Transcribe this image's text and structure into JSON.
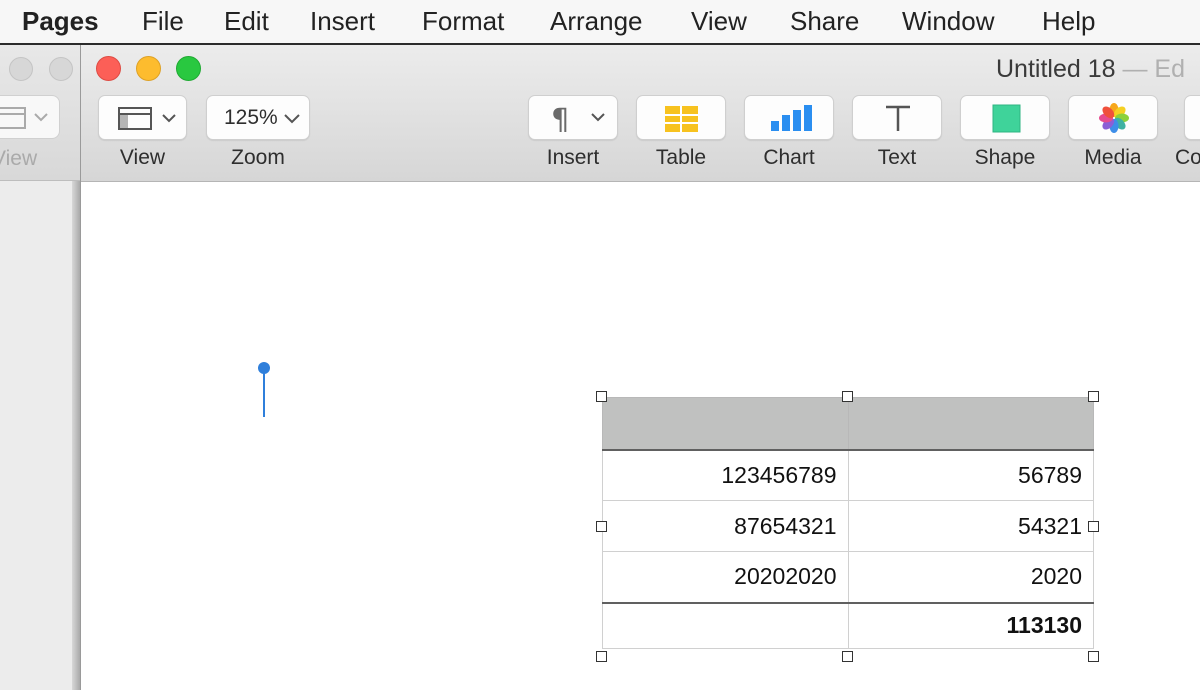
{
  "menubar": {
    "items": [
      "Pages",
      "File",
      "Edit",
      "Insert",
      "Format",
      "Arrange",
      "View",
      "Share",
      "Window",
      "Help"
    ]
  },
  "background_window": {
    "view_label": "View"
  },
  "window": {
    "title": "Untitled 18",
    "title_suffix": "— Ed"
  },
  "toolbar": {
    "view": {
      "label": "View",
      "icon": "sidebar-layout-icon"
    },
    "zoom": {
      "label": "Zoom",
      "value": "125%"
    },
    "insert": {
      "label": "Insert",
      "icon": "pilcrow-icon"
    },
    "table": {
      "label": "Table",
      "icon": "table-icon",
      "color": "#f7c21f"
    },
    "chart": {
      "label": "Chart",
      "icon": "bar-chart-icon",
      "color": "#2a8ef0"
    },
    "text": {
      "label": "Text",
      "icon": "text-t-icon"
    },
    "shape": {
      "label": "Shape",
      "icon": "square-shape-icon",
      "color": "#3fd39a"
    },
    "media": {
      "label": "Media",
      "icon": "photos-flower-icon"
    },
    "comment": {
      "label": "Co"
    }
  },
  "table": {
    "header": [
      "",
      ""
    ],
    "rows": [
      [
        "123456789",
        "56789"
      ],
      [
        "87654321",
        "54321"
      ],
      [
        "20202020",
        "2020"
      ]
    ],
    "footer": [
      "",
      "113130"
    ]
  }
}
